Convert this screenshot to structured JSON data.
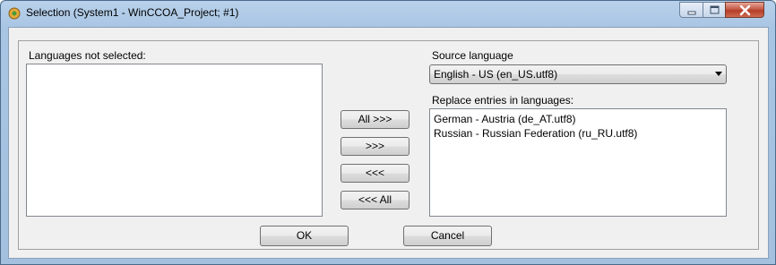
{
  "window": {
    "title": "Selection (System1 - WinCCOA_Project; #1)"
  },
  "left": {
    "label": "Languages not selected:",
    "items": []
  },
  "right": {
    "source_label": "Source language",
    "source_value": "English - US (en_US.utf8)",
    "replace_label": "Replace entries in languages:",
    "items": [
      "German - Austria (de_AT.utf8)",
      "Russian - Russian Federation (ru_RU.utf8)"
    ]
  },
  "transfer_buttons": {
    "all_right": "All >>>",
    "right": ">>>",
    "left": "<<<",
    "all_left": "<<< All"
  },
  "footer": {
    "ok": "OK",
    "cancel": "Cancel"
  }
}
